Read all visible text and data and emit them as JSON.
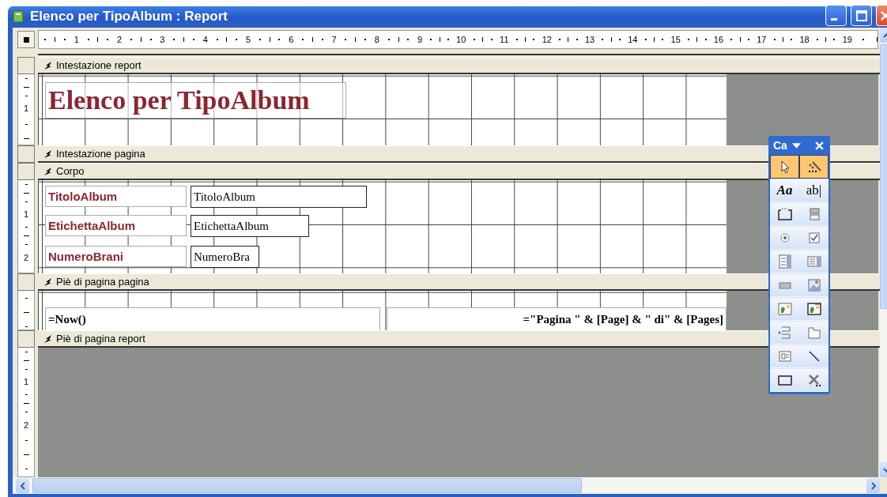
{
  "window": {
    "title": "Elenco per TipoAlbum : Report"
  },
  "ruler": {
    "marks": [
      "1",
      "2",
      "3",
      "4",
      "5",
      "6",
      "7",
      "8",
      "9",
      "10",
      "11",
      "12",
      "13",
      "14",
      "15",
      "16",
      "17",
      "18",
      "19"
    ]
  },
  "sections": [
    {
      "kind": "design",
      "title": "Intestazione report",
      "ruler_marks": [
        "1"
      ],
      "controls": [
        {
          "kind": "title",
          "text": "Elenco per TipoAlbum"
        }
      ]
    },
    {
      "kind": "empty",
      "title": "Intestazione pagina"
    },
    {
      "kind": "design",
      "title": "Corpo",
      "ruler_marks": [
        "1",
        "2"
      ],
      "controls": [
        {
          "kind": "label",
          "text": "TitoloAlbum"
        },
        {
          "kind": "textbox",
          "text": "TitoloAlbum"
        },
        {
          "kind": "label",
          "text": "EtichettaAlbum"
        },
        {
          "kind": "textbox",
          "text": "EtichettaAlbum"
        },
        {
          "kind": "label",
          "text": "NumeroBrani"
        },
        {
          "kind": "textbox",
          "text": "NumeroBra"
        }
      ]
    },
    {
      "kind": "design",
      "title": "Piè di pagina pagina",
      "controls": [
        {
          "kind": "expression",
          "text": "=Now()"
        },
        {
          "kind": "expression",
          "text": "=\"Pagina \" & [Page] & \" di\" & [Pages]"
        }
      ]
    },
    {
      "kind": "end",
      "title": "Piè di pagina report",
      "ruler_marks": [
        "1",
        "2"
      ]
    }
  ],
  "toolbox": {
    "title": "Ca",
    "tools": [
      {
        "kind": "pointer",
        "selected": true
      },
      {
        "kind": "wizard",
        "selected": true
      },
      {
        "kind": "label",
        "text": "Aa",
        "selected": false
      },
      {
        "kind": "textbox",
        "text": "ab|",
        "selected": false
      },
      {
        "kind": "option_group",
        "selected": false
      },
      {
        "kind": "toggle",
        "selected": false
      },
      {
        "kind": "option",
        "selected": false
      },
      {
        "kind": "checkbox",
        "selected": false
      },
      {
        "kind": "combo",
        "selected": false
      },
      {
        "kind": "listbox",
        "selected": false
      },
      {
        "kind": "command",
        "selected": false
      },
      {
        "kind": "image",
        "selected": false
      },
      {
        "kind": "object",
        "selected": false
      },
      {
        "kind": "bound_object",
        "selected": false
      },
      {
        "kind": "page_break",
        "selected": false
      },
      {
        "kind": "tab",
        "selected": false
      },
      {
        "kind": "subform",
        "selected": false
      },
      {
        "kind": "line",
        "selected": false
      },
      {
        "kind": "rectangle",
        "selected": false
      },
      {
        "kind": "more",
        "selected": false
      }
    ]
  }
}
